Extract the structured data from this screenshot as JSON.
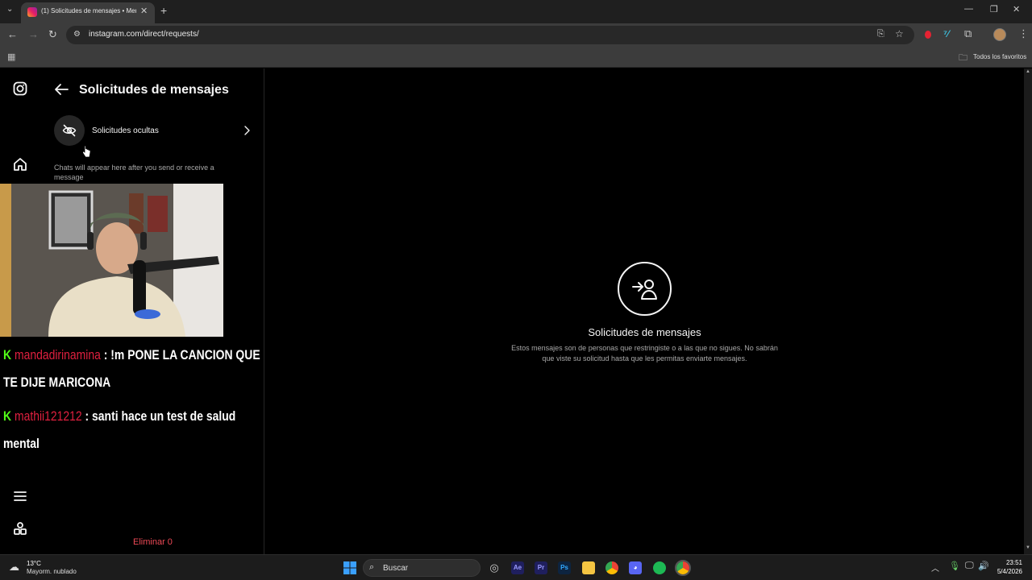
{
  "browser": {
    "tab_title": "(1) Solicitudes de mensajes • Men",
    "url": "instagram.com/direct/requests/",
    "bookmarks_folder": "Todos los favoritos"
  },
  "panel": {
    "title": "Solicitudes de mensajes",
    "hidden_requests_label": "Solicitudes ocultas",
    "empty_note": "Chats will appear here after you send or receive a message",
    "delete_link": "Eliminar 0"
  },
  "stream_chat": [
    {
      "badge": "K",
      "username": "mandadirinamina",
      "message": ": !m PONE LA CANCION QUE",
      "continuation": "TE DIJE MARICONA"
    },
    {
      "badge": "K",
      "username": "mathii121212",
      "message": ": santi hace un test de salud",
      "continuation": "mental"
    }
  ],
  "main": {
    "empty_title": "Solicitudes de mensajes",
    "empty_description": "Estos mensajes son de personas que restringiste o a las que no sigues. No sabrán que viste su solicitud hasta que les permitas enviarte mensajes."
  },
  "taskbar": {
    "weather_temp": "13°C",
    "weather_desc": "Mayorm. nublado",
    "search_label": "Buscar",
    "time": "23:51",
    "date": "5/4/2026",
    "app_labels": {
      "ae": "Ae",
      "pr": "Pr",
      "ps": "Ps"
    }
  },
  "colors": {
    "background": "#000000",
    "secondary_text": "#a8a8a8",
    "danger": "#ed4956",
    "kick_green": "#53fc18",
    "chat_username": "#e0203f"
  }
}
